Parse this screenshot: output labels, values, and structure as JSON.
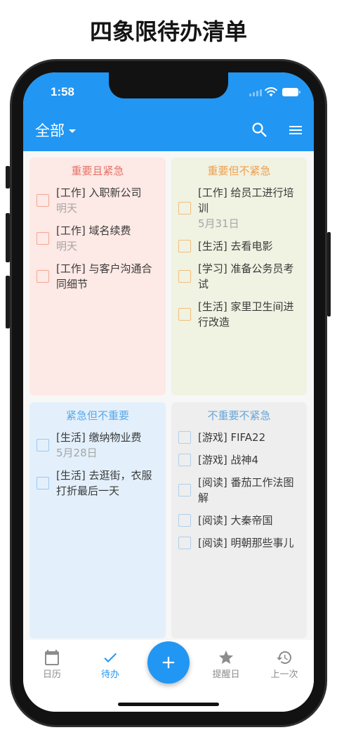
{
  "page_title": "四象限待办清单",
  "theme": {
    "primary": "#2196F3",
    "text": "#3a3a3a",
    "subtext": "#a6a6a6",
    "inactive": "#8c8c8c"
  },
  "status_bar": {
    "time": "1:58",
    "icons": [
      "signal-icon",
      "wifi-icon",
      "battery-icon"
    ]
  },
  "app_bar": {
    "filter_label": "全部",
    "filter_icon": "dropdown-caret-icon",
    "actions": [
      "search-icon",
      "menu-icon"
    ]
  },
  "quadrants": [
    {
      "title": "重要且紧急",
      "title_color": "#e5736a",
      "background": "#fde9e5",
      "checkbox_color": "#f3a795",
      "items": [
        {
          "text": "[工作] 入职新公司",
          "due": "明天",
          "checked": false
        },
        {
          "text": "[工作] 域名续费",
          "due": "明天",
          "checked": false
        },
        {
          "text": "[工作] 与客户沟通合同细节",
          "checked": false
        }
      ]
    },
    {
      "title": "重要但不紧急",
      "title_color": "#ee9f4f",
      "background": "#f0f2e2",
      "checkbox_color": "#f3be7b",
      "items": [
        {
          "text": "[工作] 给员工进行培训",
          "due": "5月31日",
          "checked": false
        },
        {
          "text": "[生活] 去看电影",
          "checked": false
        },
        {
          "text": "[学习] 准备公务员考试",
          "checked": false
        },
        {
          "text": "[生活] 家里卫生间进行改造",
          "checked": false
        }
      ]
    },
    {
      "title": "紧急但不重要",
      "title_color": "#5aa8e6",
      "background": "#e3f0fc",
      "checkbox_color": "#9ac8f0",
      "items": [
        {
          "text": "[生活] 缴纳物业费",
          "due": "5月28日",
          "checked": false
        },
        {
          "text": "[生活] 去逛街，衣服打折最后一天",
          "checked": false
        }
      ]
    },
    {
      "title": "不重要不紧急",
      "title_color": "#6aa5d8",
      "background": "#eeeeee",
      "checkbox_color": "#b0cfec",
      "items": [
        {
          "text": "[游戏] FIFA22",
          "checked": false
        },
        {
          "text": "[游戏] 战神4",
          "checked": false
        },
        {
          "text": "[阅读] 番茄工作法图解",
          "checked": false
        },
        {
          "text": "[阅读] 大秦帝国",
          "checked": false
        },
        {
          "text": "[阅读] 明朝那些事儿",
          "checked": false
        }
      ]
    }
  ],
  "bottom_nav": {
    "items": [
      {
        "label": "日历",
        "icon": "calendar-icon",
        "active": false
      },
      {
        "label": "待办",
        "icon": "check-icon",
        "active": true
      },
      {
        "label": "提醒日",
        "icon": "star-icon",
        "active": false
      },
      {
        "label": "上一次",
        "icon": "history-icon",
        "active": false
      }
    ],
    "fab_icon": "plus-icon"
  }
}
